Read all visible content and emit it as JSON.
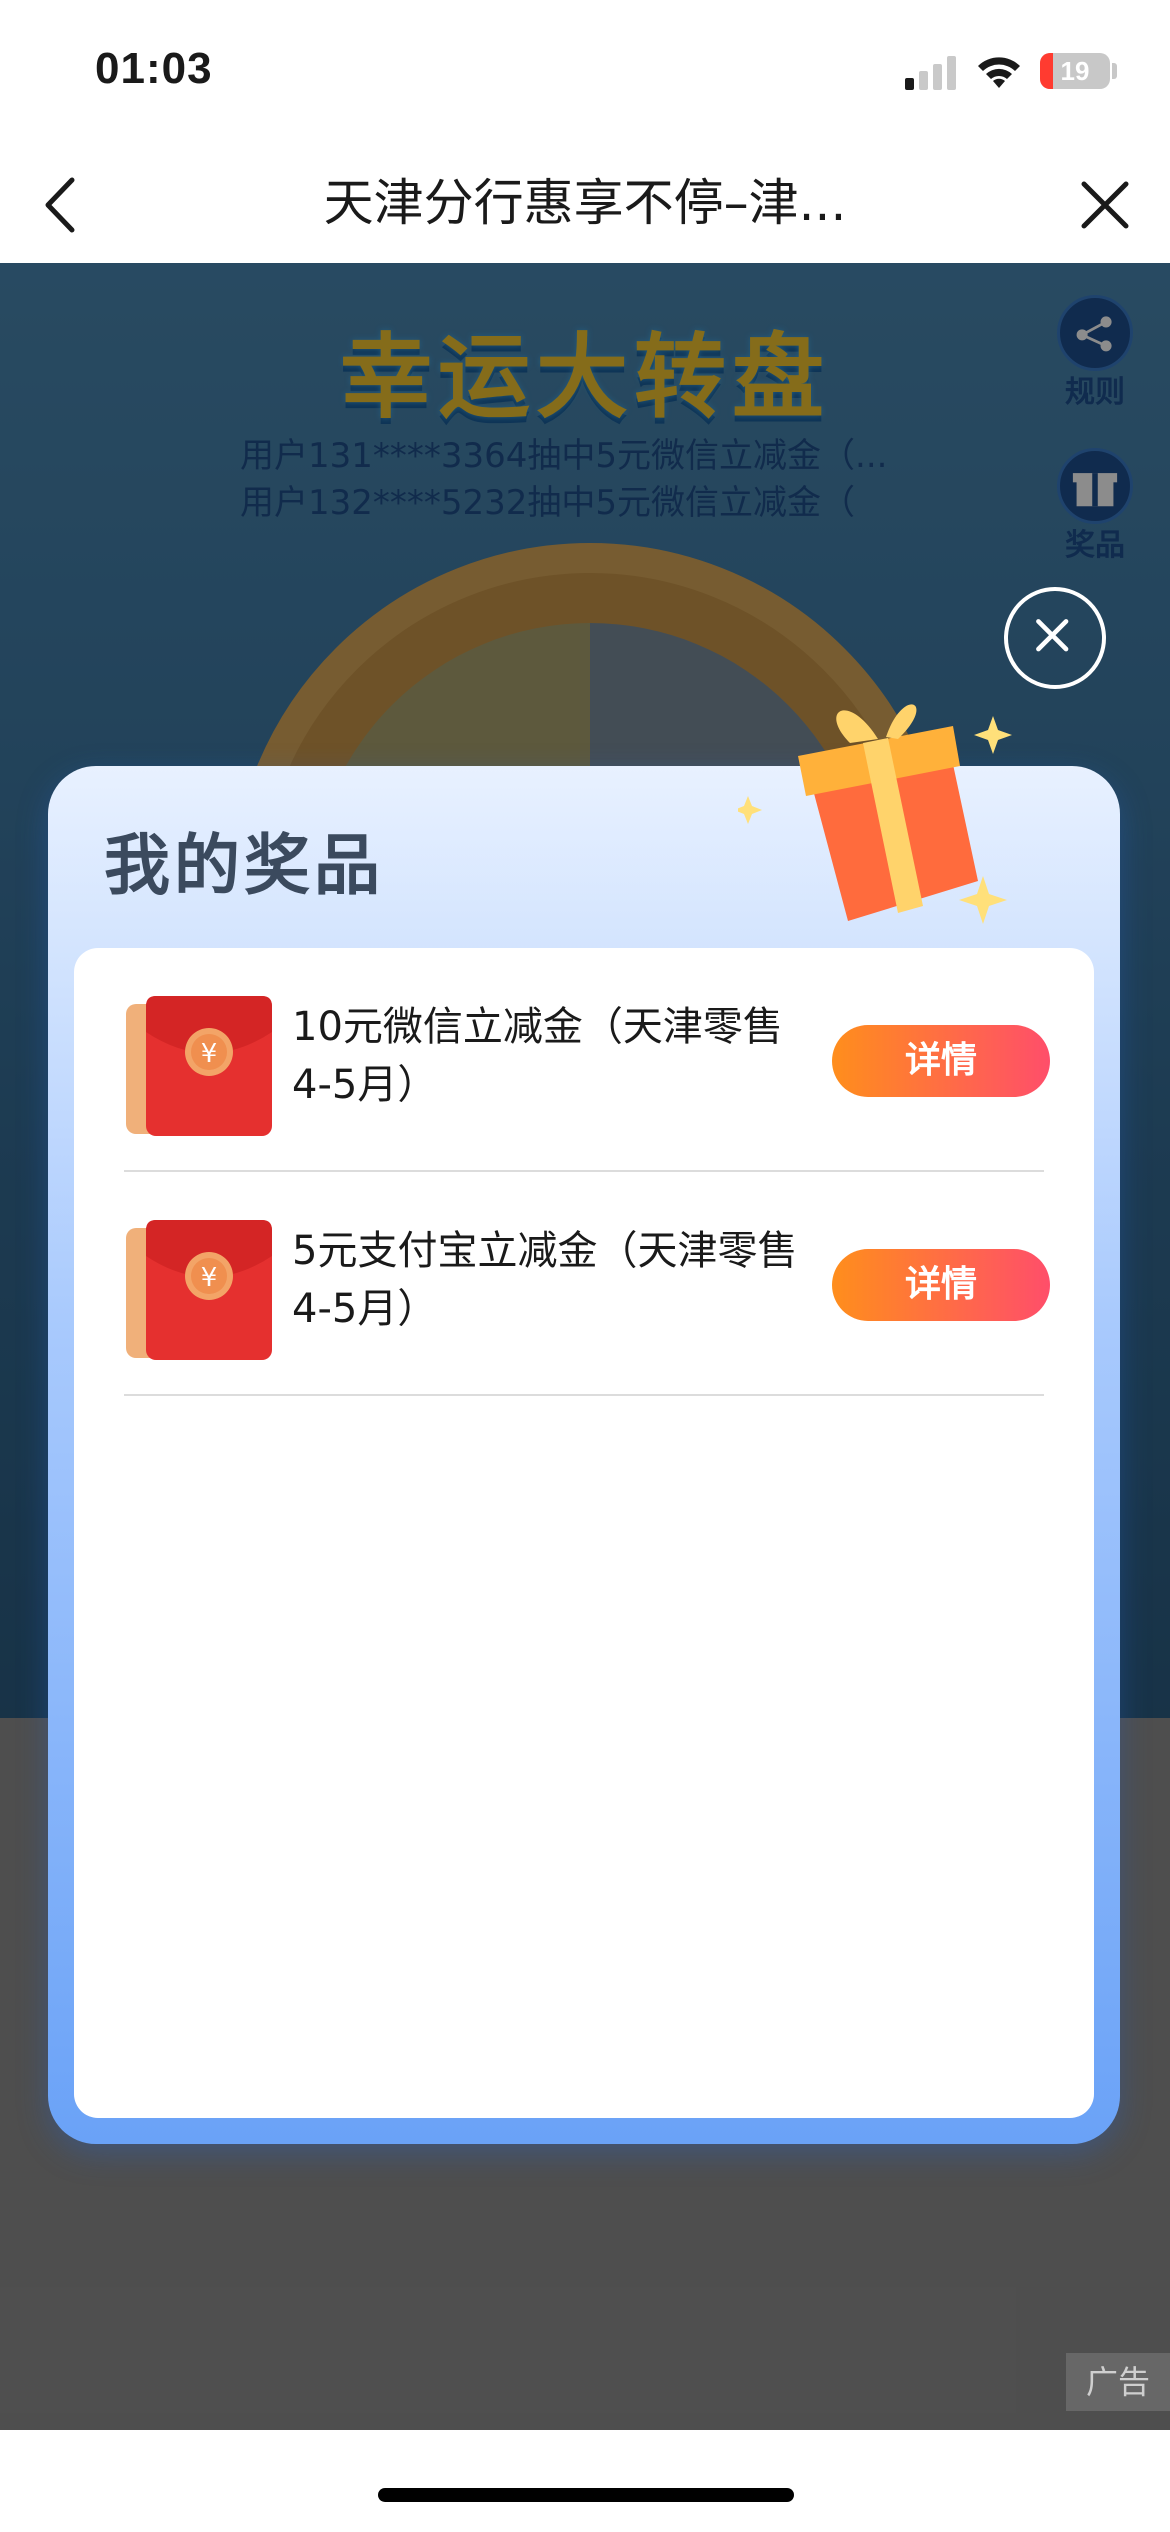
{
  "status_bar": {
    "time": "01:03",
    "battery_level": "19",
    "battery_fraction": 0.19,
    "icons": [
      "signal-icon",
      "wifi-icon",
      "battery-icon"
    ]
  },
  "nav": {
    "title": "天津分行惠享不停–津...",
    "back_icon": "chevron-left-icon",
    "close_icon": "close-icon"
  },
  "background": {
    "title": "幸运大转盘",
    "ticker": [
      "用户131****3364抽中5元微信立减金（...",
      "用户132****5232抽中5元微信立减金（"
    ],
    "side_buttons": [
      {
        "label": "规则",
        "icon": "share-icon"
      },
      {
        "label": "奖品",
        "icon": "gift-icon"
      }
    ],
    "ad_label": "广告"
  },
  "modal": {
    "title": "我的奖品",
    "close_icon": "close-circle-icon",
    "prizes": [
      {
        "name": "10元微信立减金（天津零售4-5月）",
        "button_label": "详情",
        "icon": "red-envelope-icon"
      },
      {
        "name": "5元支付宝立减金（天津零售4-5月）",
        "button_label": "详情",
        "icon": "red-envelope-icon"
      }
    ]
  },
  "colors": {
    "button_gradient_start": "#ff8e1c",
    "button_gradient_end": "#ff4e6a",
    "modal_blue": "#6aa2f7",
    "envelope_red": "#e5302f"
  }
}
